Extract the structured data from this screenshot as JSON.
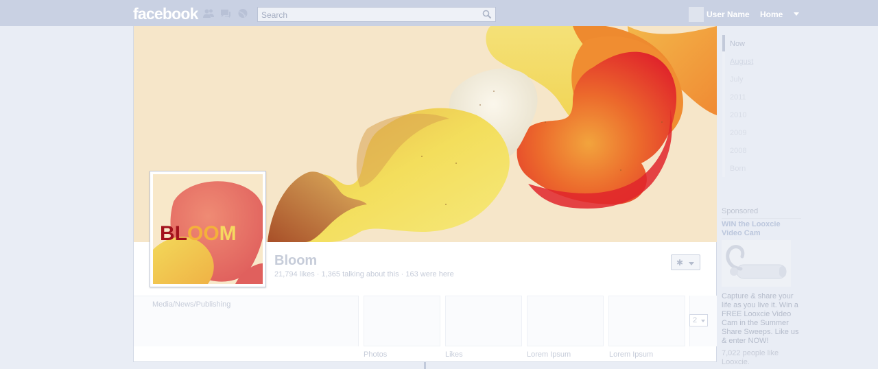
{
  "header": {
    "logo": "facebook",
    "search_placeholder": "Search",
    "user_name": "User Name",
    "home_label": "Home"
  },
  "page": {
    "name": "Bloom",
    "stats": "21,794 likes · 1,365 talking about this · 163 were here",
    "category": "Media/News/Publishing",
    "logo_text": {
      "left": "BL",
      "middle": "OO",
      "right": "M"
    },
    "apps": [
      {
        "label": "Photos"
      },
      {
        "label": "Likes"
      },
      {
        "label": "Lorem Ipsum"
      },
      {
        "label": "Lorem Ipsum"
      }
    ],
    "more_count": "2"
  },
  "timeline_nav": {
    "items": [
      "Now",
      "August",
      "July",
      "2011",
      "2010",
      "2009",
      "2008",
      "Born"
    ]
  },
  "sidebar": {
    "sponsored_label": "Sponsored",
    "ad": {
      "title": "WIN the Looxcie Video Cam",
      "body": "Capture & share your life as you live it. Win a FREE Looxcie Video Cam in the Summer Share Sweeps. Like us & enter NOW!",
      "likes": "7,022 people like Looxcie."
    }
  },
  "colors": {
    "topbar": "#c9d1e3",
    "background": "#e9edf5",
    "cover_bg": "#f6e6c9",
    "bloom_red": "#e22a2d",
    "bloom_orange": "#f0812e",
    "bloom_yellow": "#f1dd5c",
    "logo_maroon": "#a3121c"
  }
}
